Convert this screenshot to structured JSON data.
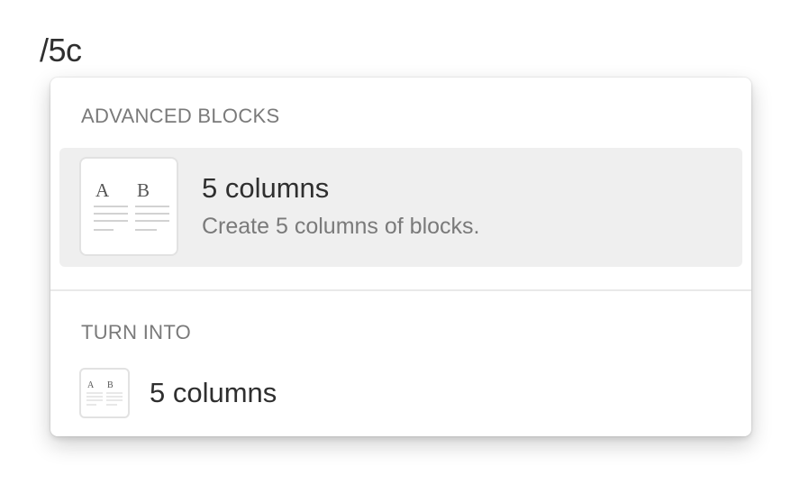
{
  "command": {
    "text": "/5c"
  },
  "menu": {
    "sections": {
      "advanced": {
        "label": "ADVANCED BLOCKS",
        "item": {
          "title": "5 columns",
          "description": "Create 5 columns of blocks.",
          "thumb_letters": [
            "A",
            "B"
          ]
        }
      },
      "turn_into": {
        "label": "TURN INTO",
        "item": {
          "title": "5 columns",
          "thumb_letters": [
            "A",
            "B"
          ]
        }
      }
    }
  },
  "colors": {
    "highlight": "#efefef",
    "primary_text": "#2f2f2f",
    "secondary_text": "#7a7a7a"
  },
  "icons": {
    "advanced_item": "columns-icon",
    "turn_into_item": "columns-icon"
  }
}
